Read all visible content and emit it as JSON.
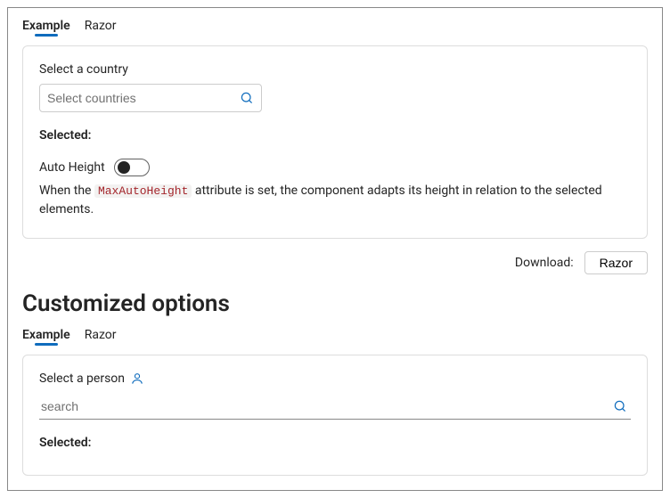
{
  "section1": {
    "tabs": [
      {
        "label": "Example",
        "active": true
      },
      {
        "label": "Razor",
        "active": false
      }
    ],
    "country_label": "Select a country",
    "country_placeholder": "Select countries",
    "selected_label": "Selected:",
    "autoheight_label": "Auto Height",
    "autoheight_on": false,
    "description_prefix": "When the ",
    "description_code": "MaxAutoHeight",
    "description_suffix": " attribute is set, the component adapts its height in relation to the selected elements."
  },
  "download": {
    "label": "Download:",
    "button": "Razor"
  },
  "heading": "Customized options",
  "section2": {
    "tabs": [
      {
        "label": "Example",
        "active": true
      },
      {
        "label": "Razor",
        "active": false
      }
    ],
    "person_label": "Select a person",
    "person_placeholder": "search",
    "selected_label": "Selected:"
  }
}
